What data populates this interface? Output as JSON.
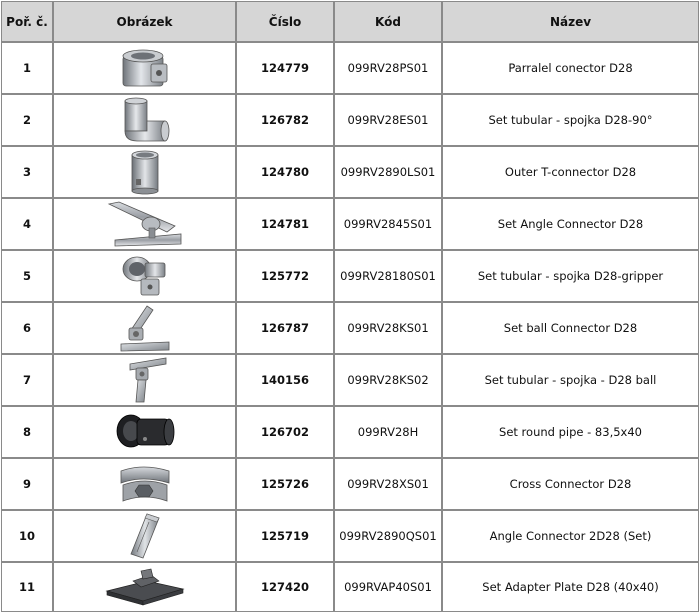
{
  "headers": {
    "num": "Poř. č.",
    "image": "Obrázek",
    "cislo": "Číslo",
    "kod": "Kód",
    "nazev": "Název"
  },
  "rows": [
    {
      "num": "1",
      "icon": "parallel-connector-icon",
      "cislo": "124779",
      "kod": "099RV28PS01",
      "nazev": "Parralel conector D28"
    },
    {
      "num": "2",
      "icon": "elbow-connector-icon",
      "cislo": "126782",
      "kod": "099RV28ES01",
      "nazev": "Set tubular - spojka D28-90°"
    },
    {
      "num": "3",
      "icon": "t-connector-icon",
      "cislo": "124780",
      "kod": "099RV2890LS01",
      "nazev": "Outer T-connector D28"
    },
    {
      "num": "4",
      "icon": "angle-connector-icon",
      "cislo": "124781",
      "kod": "099RV2845S01",
      "nazev": "Set Angle Connector D28"
    },
    {
      "num": "5",
      "icon": "gripper-connector-icon",
      "cislo": "125772",
      "kod": "099RV28180S01",
      "nazev": "Set tubular - spojka D28-gripper"
    },
    {
      "num": "6",
      "icon": "ball-connector-icon",
      "cislo": "126787",
      "kod": "099RV28KS01",
      "nazev": "Set ball Connector D28"
    },
    {
      "num": "7",
      "icon": "ball-connector-2-icon",
      "cislo": "140156",
      "kod": "099RV28KS02",
      "nazev": "Set tubular - spojka - D28 ball"
    },
    {
      "num": "8",
      "icon": "round-pipe-icon",
      "cislo": "126702",
      "kod": "099RV28H",
      "nazev": "Set round pipe - 83,5x40"
    },
    {
      "num": "9",
      "icon": "cross-connector-icon",
      "cislo": "125726",
      "kod": "099RV28XS01",
      "nazev": "Cross Connector D28"
    },
    {
      "num": "10",
      "icon": "angle-connector-2d-icon",
      "cislo": "125719",
      "kod": "099RV2890QS01",
      "nazev": "Angle Connector 2D28 (Set)"
    },
    {
      "num": "11",
      "icon": "adapter-plate-icon",
      "cislo": "127420",
      "kod": "099RVAP40S01",
      "nazev": "Set Adapter Plate D28 (40x40)"
    }
  ]
}
